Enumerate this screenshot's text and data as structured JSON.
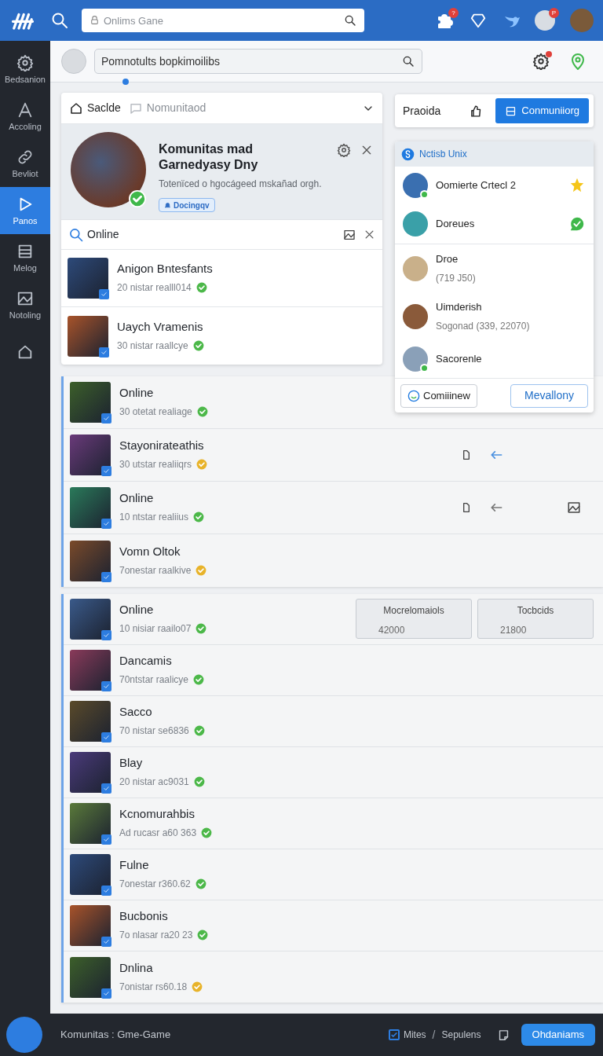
{
  "top_bar": {
    "search": {
      "placeholder": "Onlims Gane"
    },
    "badges": [
      {
        "text": "?"
      },
      {
        "text": "P"
      }
    ]
  },
  "sidebar": {
    "items": [
      {
        "label": "Bedsanion",
        "selected": false
      },
      {
        "label": "Accoling",
        "selected": false
      },
      {
        "label": "Bevliot",
        "selected": false
      },
      {
        "label": "Panos",
        "selected": true
      },
      {
        "label": "Melog",
        "selected": false
      },
      {
        "label": "Notoling",
        "selected": false
      },
      {
        "selected": false
      }
    ]
  },
  "sub_bar": {
    "search": {
      "value": "Pomnotults bopkimoilibs"
    }
  },
  "community_card": {
    "tabs": [
      {
        "label": "Saclde",
        "selected": true
      },
      {
        "label": "Nomunitaod",
        "selected": false
      }
    ],
    "title": "Komunitas mad Garnedyasy Dny",
    "description": "Totenïced o hgocágeed mskañad orgh.",
    "tag": "Docingqv",
    "filter": {
      "value": "Online"
    },
    "rows": [
      {
        "name": "Anigon Bntesfants",
        "detail": "20 nistar realll014",
        "color": "#4cb849"
      },
      {
        "name": "Uaych Vramenis",
        "detail": "30 nistar raallcye",
        "color": "#4cb849"
      }
    ]
  },
  "action_card": {
    "label": "Praoida",
    "button": "Conmuniiorg"
  },
  "friends_panel": {
    "title": "Nctisb Unix",
    "friends": [
      {
        "name": "Oomierte Crtecl 2",
        "online": true,
        "kind": "star"
      },
      {
        "name": "Doreues",
        "online": false,
        "kind": "chat"
      },
      {
        "name": "Droe",
        "detail": "(719 J50)",
        "online": false,
        "kind": "plain"
      },
      {
        "name": "Uimderish",
        "detail": "Sogonad (339, 22070)",
        "online": false,
        "kind": "plain"
      },
      {
        "name": "Sacorenle",
        "online": true,
        "kind": "plain"
      }
    ],
    "buttons": [
      {
        "label": "Comiiinew",
        "kind": "secondary"
      },
      {
        "label": "Mevallony",
        "kind": "primary"
      }
    ]
  },
  "list_1": [
    {
      "name": "Online",
      "detail": "30 otetat realiage",
      "color": "#4cb849",
      "kind": "plain"
    },
    {
      "name": "Stayonirateathis",
      "detail": "30 utstar realiiqrs",
      "color": "#e8b32a",
      "kind": "actions"
    },
    {
      "name": "Online",
      "detail": "10 ntstar realiius",
      "color": "#4cb849",
      "kind": "actions_media"
    },
    {
      "name": "Vomn Oltok",
      "detail": "7onestar raalkive",
      "color": "#e8b32a",
      "kind": "plain"
    }
  ],
  "list_2": [
    {
      "name": "Online",
      "detail": "10 nisiar raailo07",
      "color": "#4cb849",
      "kind": "stats",
      "stats": [
        {
          "label": "Mocrelomaiols",
          "value": "42000"
        },
        {
          "label": "Tocbcids",
          "value": "21800"
        }
      ]
    },
    {
      "name": "Dancamis",
      "detail": "70ntstar raalicye",
      "color": "#4cb849",
      "kind": "plain"
    },
    {
      "name": "Sacco",
      "detail": "70 nistar se6836",
      "color": "#4cb849",
      "kind": "plain"
    },
    {
      "name": "Blay",
      "detail": "20 nistar ac9031",
      "color": "#4cb849",
      "kind": "plain"
    },
    {
      "name": "Kcnomurahbis",
      "detail": "Ad rucasr a60 363",
      "color": "#4cb849",
      "kind": "plain"
    },
    {
      "name": "Fulne",
      "detail": "7onestar r360.62",
      "color": "#4cb849",
      "kind": "plain"
    },
    {
      "name": "Bucbonis",
      "detail": "7o nlasar ra20 23",
      "color": "#4cb849",
      "kind": "plain"
    },
    {
      "name": "Dnlina",
      "detail": "7onistar rs60.18",
      "color": "#e8b32a",
      "kind": "plain"
    }
  ],
  "footer": {
    "title": "Komunitas : Gme-Game",
    "check": {
      "label": "Mites",
      "checked": true
    },
    "separator": "/",
    "link": "Sepulens",
    "button": "Ohdaniams"
  }
}
